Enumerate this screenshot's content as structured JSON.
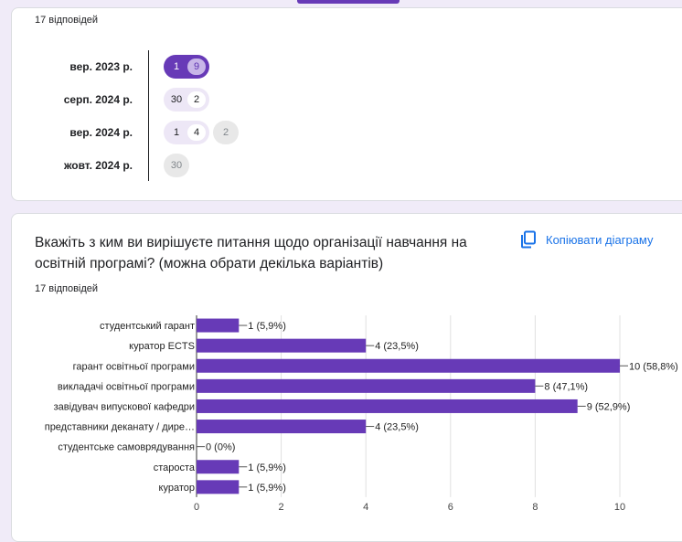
{
  "date_card": {
    "response_count": "17 відповідей",
    "rows": [
      {
        "label": "вер. 2023 р.",
        "groups": [
          {
            "style": "dark",
            "items": [
              {
                "n": "1",
                "hl": false
              },
              {
                "n": "9",
                "hl": true
              }
            ]
          }
        ]
      },
      {
        "label": "серп. 2024 р.",
        "groups": [
          {
            "style": "light",
            "items": [
              {
                "n": "30",
                "hl": false
              },
              {
                "n": "2",
                "hl": true
              }
            ]
          }
        ]
      },
      {
        "label": "вер. 2024 р.",
        "groups": [
          {
            "style": "light",
            "items": [
              {
                "n": "1",
                "hl": false
              },
              {
                "n": "4",
                "hl": true
              }
            ]
          },
          {
            "style": "grey",
            "items": [
              {
                "n": "2",
                "hl": false
              }
            ]
          }
        ]
      },
      {
        "label": "жовт. 2024 р.",
        "groups": [
          {
            "style": "grey",
            "items": [
              {
                "n": "30",
                "hl": false
              }
            ]
          }
        ]
      }
    ]
  },
  "question_card": {
    "title": "Вкажіть з ким ви вирішуєте питання щодо організації навчання на освітній програмі? (можна обрати декілька варіантів)",
    "copy_label": "Копіювати діаграму",
    "copy_icon": "copy-icon",
    "response_count": "17 відповідей"
  },
  "colors": {
    "bar": "#673ab7",
    "link": "#1a73e8",
    "background": "#f0ebf8"
  },
  "chart_data": {
    "type": "bar",
    "orientation": "horizontal",
    "categories": [
      "студентський гарант",
      "куратор ECTS",
      "гарант освітньої програми",
      "викладачі освітньої програми",
      "завідувач випускової кафедри",
      "представники деканату / дире…",
      "студентське самоврядування",
      "староста",
      "куратор"
    ],
    "values": [
      1,
      4,
      10,
      8,
      9,
      4,
      0,
      1,
      1
    ],
    "data_labels": [
      "1 (5,9%)",
      "4 (23,5%)",
      "10 (58,8%)",
      "8 (47,1%)",
      "9 (52,9%)",
      "4 (23,5%)",
      "0 (0%)",
      "1 (5,9%)",
      "1 (5,9%)"
    ],
    "x_ticks": [
      "0",
      "2",
      "4",
      "6",
      "8",
      "10"
    ],
    "xlim": [
      0,
      10
    ],
    "grid": true
  }
}
